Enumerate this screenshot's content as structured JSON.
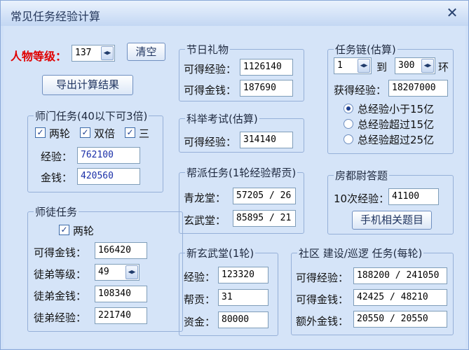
{
  "window": {
    "title": "常见任务经验计算",
    "close_symbol": "✕"
  },
  "level": {
    "label": "人物等级：",
    "value": "137",
    "clear_button": "清空"
  },
  "export_button": "导出计算结果",
  "master": {
    "legend": "师门任务(40以下可3倍)",
    "checks": [
      {
        "label": "两轮",
        "checked": true
      },
      {
        "label": "双倍",
        "checked": true
      },
      {
        "label": "三",
        "checked": true
      }
    ],
    "exp_label": "经验：",
    "exp_value": "762100",
    "money_label": "金钱：",
    "money_value": "420560"
  },
  "apprentice": {
    "legend": "师徒任务",
    "check_label": "两轮",
    "money_label": "可得金钱：",
    "money_value": "166420",
    "level_label": "徒弟等级：",
    "level_value": "49",
    "app_money_label": "徒弟金钱：",
    "app_money_value": "108340",
    "app_exp_label": "徒弟经验：",
    "app_exp_value": "221740"
  },
  "festival": {
    "legend": "节日礼物",
    "exp_label": "可得经验：",
    "exp_value": "1126140",
    "money_label": "可得金钱：",
    "money_value": "187690"
  },
  "exam": {
    "legend": "科举考试(估算)",
    "exp_label": "可得经验：",
    "exp_value": "314140"
  },
  "gang": {
    "legend": "帮派任务(1轮经验帮贡)",
    "row1_label": "青龙堂：",
    "row1_value": "57205 / 26",
    "row2_label": "玄武堂：",
    "row2_value": "85895 / 21"
  },
  "xuanwu": {
    "legend": "新玄武堂(1轮)",
    "exp_label": "经验：",
    "exp_value": "123320",
    "contrib_label": "帮贡：",
    "contrib_value": "31",
    "funds_label": "资金：",
    "funds_value": "80000"
  },
  "chain": {
    "legend": "任务链(估算)",
    "from_value": "1",
    "to_label": "到",
    "to_value": "300",
    "ring_label": "环",
    "exp_label": "获得经验：",
    "exp_value": "18207000",
    "options": [
      {
        "label": "总经验小于15亿",
        "selected": true
      },
      {
        "label": "总经验超过15亿",
        "selected": false
      },
      {
        "label": "总经验超过25亿",
        "selected": false
      }
    ]
  },
  "quiz": {
    "legend": "房都尉答题",
    "exp_label": "10次经验：",
    "exp_value": "41100",
    "button": "手机相关题目"
  },
  "community": {
    "legend": "社区 建设/巡逻 任务(每轮)",
    "exp_label": "可得经验：",
    "exp_value": "188200 / 241050",
    "money_label": "可得金钱：",
    "money_value": "42425 / 48210",
    "extra_label": "额外金钱：",
    "extra_value": "20550 / 20550"
  }
}
